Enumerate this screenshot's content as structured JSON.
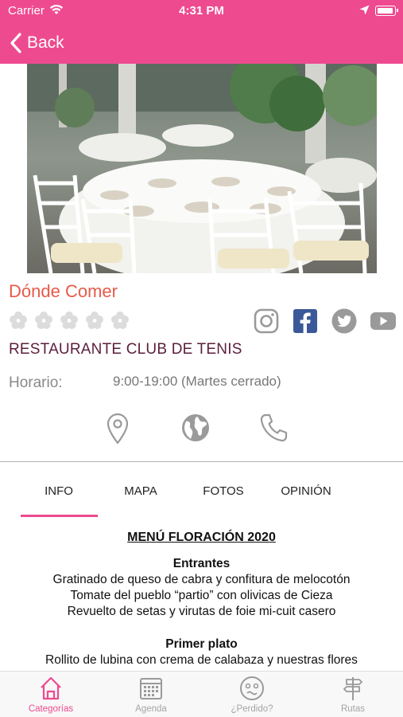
{
  "status_bar": {
    "carrier": "Carrier",
    "time": "4:31 PM"
  },
  "nav": {
    "back_label": "Back"
  },
  "detail": {
    "section_title": "Dónde Comer",
    "rating_max": 5,
    "rating": 0,
    "name": "RESTAURANTE CLUB DE TENIS",
    "hours_label": "Horario:",
    "hours_value": "9:00-19:00 (Martes cerrado)"
  },
  "social_icons": [
    "instagram-icon",
    "facebook-icon",
    "twitter-icon",
    "youtube-icon"
  ],
  "contact_icons": [
    "location-pin-icon",
    "globe-icon",
    "phone-icon"
  ],
  "tabs": [
    {
      "label": "INFO",
      "active": true
    },
    {
      "label": "MAPA",
      "active": false
    },
    {
      "label": "FOTOS",
      "active": false
    },
    {
      "label": "OPINIÓN",
      "active": false
    }
  ],
  "menu": {
    "title": "MENÚ FLORACIÓN 2020",
    "sections": [
      {
        "heading": "Entrantes",
        "items": [
          "Gratinado de queso de cabra y confitura de melocotón",
          "Tomate del pueblo “partio” con olivicas de Cieza",
          "Revuelto de setas y virutas de foie mi-cuit casero"
        ]
      },
      {
        "heading": "Primer plato",
        "items": [
          "Rollito de lubina con crema de calabaza y nuestras flores"
        ]
      }
    ]
  },
  "tab_bar": [
    {
      "label": "Categorías",
      "icon": "home-icon",
      "active": true
    },
    {
      "label": "Agenda",
      "icon": "calendar-icon",
      "active": false
    },
    {
      "label": "¿Perdido?",
      "icon": "confused-face-icon",
      "active": false
    },
    {
      "label": "Rutas",
      "icon": "signpost-icon",
      "active": false
    }
  ],
  "colors": {
    "accent": "#ee4a90",
    "title_red": "#e75a4a",
    "name_maroon": "#5b1f3c",
    "facebook_blue": "#3b5998"
  }
}
